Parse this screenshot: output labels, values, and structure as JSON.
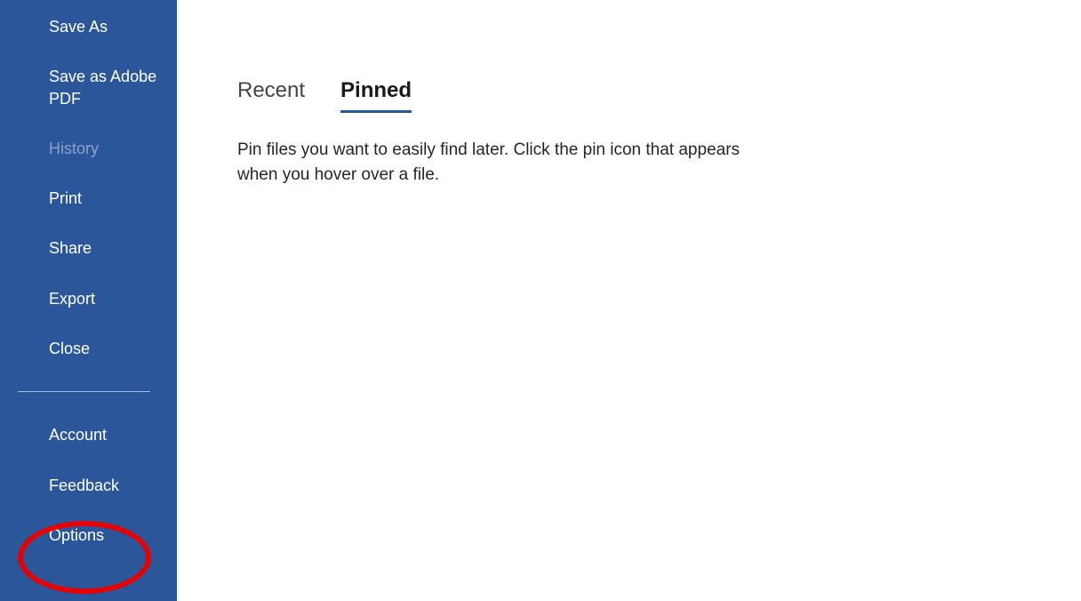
{
  "sidebar": {
    "items": [
      {
        "label": "Save As",
        "disabled": false
      },
      {
        "label": "Save as Adobe PDF",
        "disabled": false
      },
      {
        "label": "History",
        "disabled": true
      },
      {
        "label": "Print",
        "disabled": false
      },
      {
        "label": "Share",
        "disabled": false
      },
      {
        "label": "Export",
        "disabled": false
      },
      {
        "label": "Close",
        "disabled": false
      }
    ],
    "bottomItems": [
      {
        "label": "Account"
      },
      {
        "label": "Feedback"
      },
      {
        "label": "Options"
      }
    ]
  },
  "main": {
    "tabs": [
      {
        "label": "Recent",
        "active": false
      },
      {
        "label": "Pinned",
        "active": true
      }
    ],
    "pinnedEmptyText": "Pin files you want to easily find later. Click the pin icon that appears when you hover over a file."
  },
  "annotation": {
    "highlightedItem": "Options"
  }
}
